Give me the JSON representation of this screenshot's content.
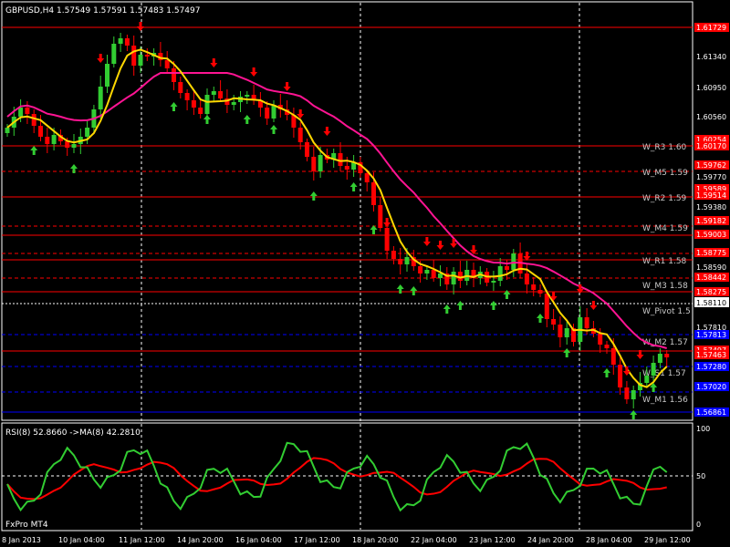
{
  "main": {
    "header": "GBPUSD,H4  1.57549 1.57591 1.57483 1.57497",
    "price_axis": [
      "1.61340",
      "1.60950",
      "1.60560",
      "1.59770",
      "1.59380",
      "1.58590",
      "1.57810"
    ],
    "current_price": "1.58110",
    "price_tags": [
      {
        "label": "1.61729",
        "color": "#ff0000"
      },
      {
        "label": "1.60254",
        "color": "#ff0000"
      },
      {
        "label": "1.60170",
        "color": "#ff0000"
      },
      {
        "label": "1.59762",
        "color": "#ff0000"
      },
      {
        "label": "1.59589",
        "color": "#ff0000"
      },
      {
        "label": "1.59514",
        "color": "#ff0000"
      },
      {
        "label": "1.59182",
        "color": "#ff0000"
      },
      {
        "label": "1.59003",
        "color": "#ff0000"
      },
      {
        "label": "1.58775",
        "color": "#ff0000"
      },
      {
        "label": "1.58442",
        "color": "#ff0000"
      },
      {
        "label": "1.58275",
        "color": "#ff0000"
      },
      {
        "label": "1.57813",
        "color": "#0000ff"
      },
      {
        "label": "1.57497",
        "color": "#ff0000"
      },
      {
        "label": "1.57463",
        "color": "#ff0000"
      },
      {
        "label": "1.57280",
        "color": "#0000ff"
      },
      {
        "label": "1.57020",
        "color": "#0000ff"
      },
      {
        "label": "1.56861",
        "color": "#0000ff"
      }
    ],
    "level_labels": [
      "W_R3 1.60",
      "W_M5 1.59",
      "W_R2 1.59",
      "W_M4 1.59",
      "W_R1 1.58",
      "W_M3 1.58",
      "W_Pivot 1.5",
      "W_M2 1.57",
      "W_S1 1.57",
      "W_M1 1.56"
    ]
  },
  "rsi": {
    "label": "RSI(8) 52.8660   ->MA(8) 42.2810",
    "axis": [
      "100",
      "50",
      "0"
    ]
  },
  "footer": {
    "brand": "FxPro MT4",
    "dates": [
      "8 Jan 2013",
      "10 Jan 04:00",
      "11 Jan 12:00",
      "14 Jan 20:00",
      "16 Jan 04:00",
      "17 Jan 12:00",
      "18 Jan 20:00",
      "22 Jan 04:00",
      "23 Jan 12:00",
      "24 Jan 20:00",
      "28 Jan 04:00",
      "29 Jan 12:00"
    ]
  },
  "colors": {
    "bg": "#000000",
    "bull": "#32cd32",
    "bear": "#ff0000",
    "ma_fast": "#ffd700",
    "ma_slow": "#ff1493",
    "rsi": "#32cd32",
    "rsi_ma": "#ff0000",
    "resistance": "#ff0000",
    "support": "#0000ff"
  }
}
